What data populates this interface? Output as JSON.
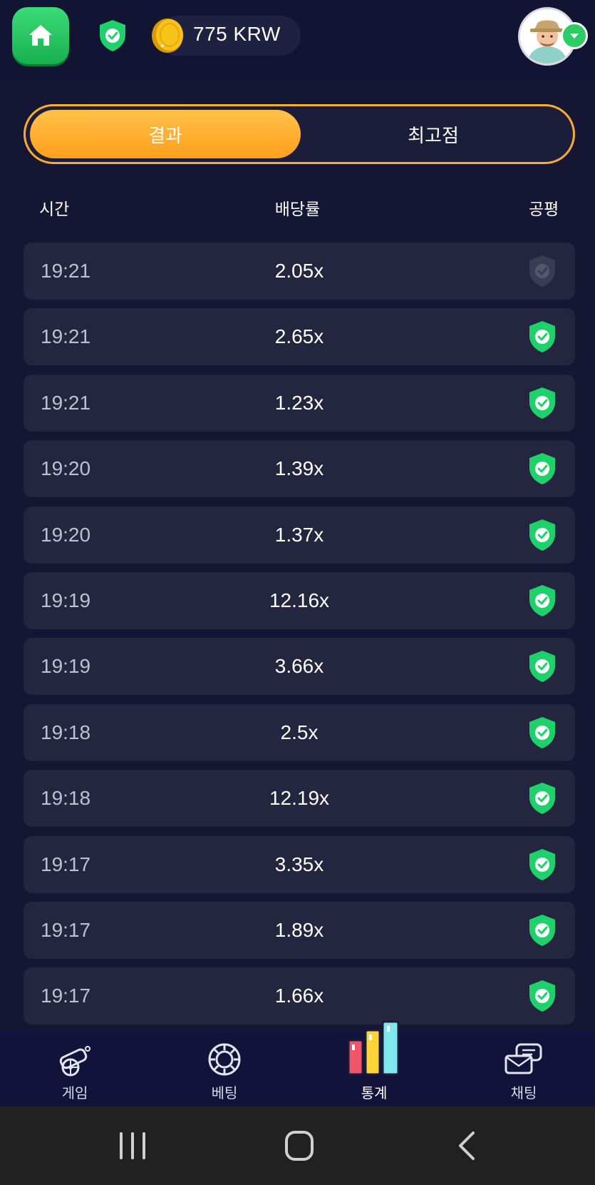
{
  "header": {
    "balance": "775 KRW",
    "icons": {
      "home": "home-icon",
      "shield": "verified-shield-icon",
      "coin": "coin-icon",
      "avatar": "avatar",
      "avatar_dropdown": "chevron-down-icon"
    }
  },
  "tabs": [
    {
      "label": "결과",
      "active": true
    },
    {
      "label": "최고점",
      "active": false
    }
  ],
  "columns": {
    "time": "시간",
    "multiplier": "배당률",
    "fair": "공평"
  },
  "rows": [
    {
      "time": "19:21",
      "multiplier": "2.05x",
      "verified": false
    },
    {
      "time": "19:21",
      "multiplier": "2.65x",
      "verified": true
    },
    {
      "time": "19:21",
      "multiplier": "1.23x",
      "verified": true
    },
    {
      "time": "19:20",
      "multiplier": "1.39x",
      "verified": true
    },
    {
      "time": "19:20",
      "multiplier": "1.37x",
      "verified": true
    },
    {
      "time": "19:19",
      "multiplier": "12.16x",
      "verified": true
    },
    {
      "time": "19:19",
      "multiplier": "3.66x",
      "verified": true
    },
    {
      "time": "19:18",
      "multiplier": "2.5x",
      "verified": true
    },
    {
      "time": "19:18",
      "multiplier": "12.19x",
      "verified": true
    },
    {
      "time": "19:17",
      "multiplier": "3.35x",
      "verified": true
    },
    {
      "time": "19:17",
      "multiplier": "1.89x",
      "verified": true
    },
    {
      "time": "19:17",
      "multiplier": "1.66x",
      "verified": true
    }
  ],
  "bottom_nav": [
    {
      "label": "게임",
      "icon": "cannon-icon",
      "active": false
    },
    {
      "label": "베팅",
      "icon": "chip-icon",
      "active": false
    },
    {
      "label": "통계",
      "icon": "bar-chart-icon",
      "active": true
    },
    {
      "label": "채팅",
      "icon": "chat-icon",
      "active": false
    }
  ],
  "colors": {
    "background": "#151633",
    "row": "#24253f",
    "accent": "#f6ae2d",
    "verified": "#1ed16a",
    "unverified": "#3a3c55"
  }
}
